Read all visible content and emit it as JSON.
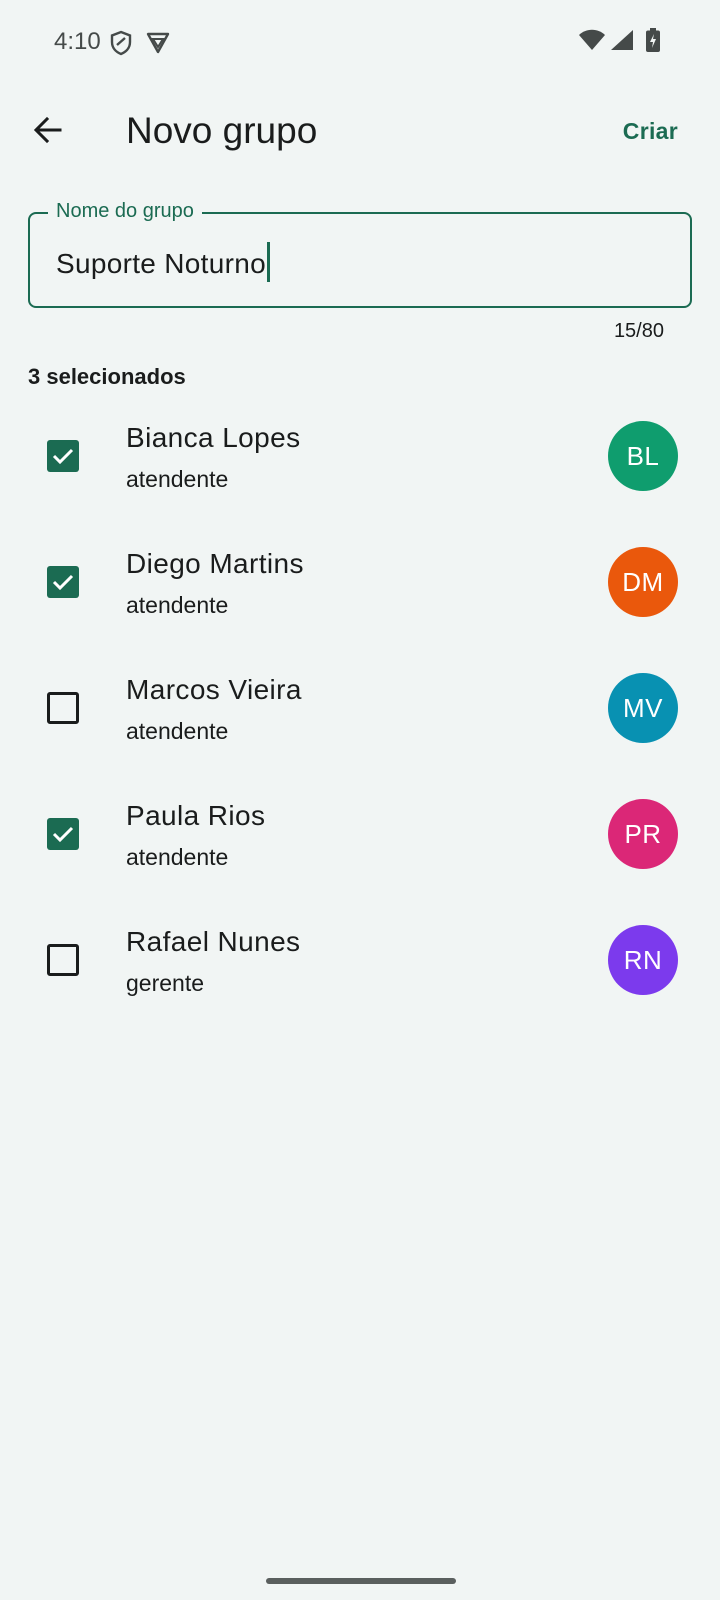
{
  "status_bar": {
    "time": "4:10",
    "icons": [
      "shield-icon",
      "vpn-icon",
      "wifi-icon",
      "signal-icon",
      "battery-charging-icon"
    ]
  },
  "app_bar": {
    "back_icon": "arrow-back-icon",
    "title": "Novo grupo",
    "action_label": "Criar"
  },
  "group_name_field": {
    "label": "Nome do grupo",
    "value": "Suporte Noturno",
    "counter": "15/80"
  },
  "selected_summary": "3 selecionados",
  "members": [
    {
      "name": "Bianca Lopes",
      "role": "atendente",
      "initials": "BL",
      "checked": true,
      "avatar_color": "#0f9d6e"
    },
    {
      "name": "Diego Martins",
      "role": "atendente",
      "initials": "DM",
      "checked": true,
      "avatar_color": "#ea580c"
    },
    {
      "name": "Marcos Vieira",
      "role": "atendente",
      "initials": "MV",
      "checked": false,
      "avatar_color": "#0891b2"
    },
    {
      "name": "Paula Rios",
      "role": "atendente",
      "initials": "PR",
      "checked": true,
      "avatar_color": "#db2777"
    },
    {
      "name": "Rafael Nunes",
      "role": "gerente",
      "initials": "RN",
      "checked": false,
      "avatar_color": "#7c3aed"
    }
  ],
  "colors": {
    "accent": "#1b6b52",
    "background": "#f1f5f4"
  }
}
